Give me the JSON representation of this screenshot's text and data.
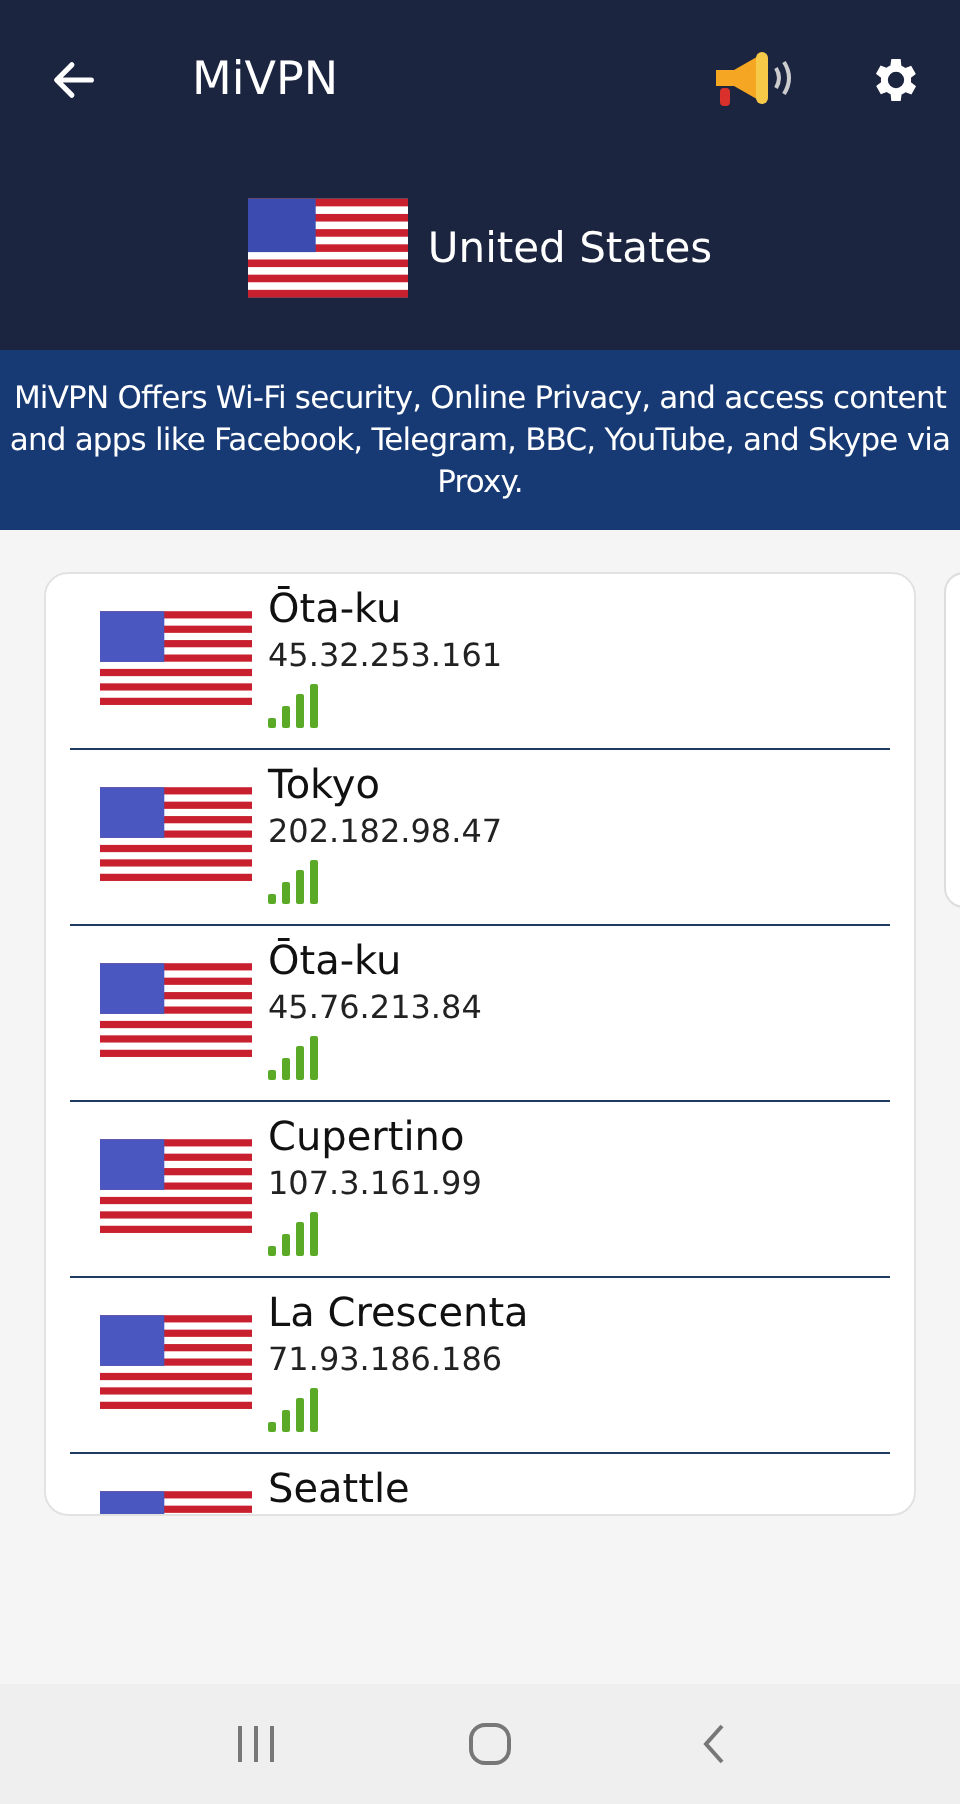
{
  "app_bar": {
    "title": "MiVPN"
  },
  "country": {
    "name": "United States"
  },
  "banner": {
    "text": "MiVPN Offers Wi-Fi security, Online Privacy, and access content and apps like Facebook, Telegram, BBC, YouTube, and Skype via Proxy."
  },
  "servers": [
    {
      "city": "Ōta-ku",
      "ip": "45.32.253.161"
    },
    {
      "city": "Tokyo",
      "ip": "202.182.98.47"
    },
    {
      "city": "Ōta-ku",
      "ip": "45.76.213.84"
    },
    {
      "city": "Cupertino",
      "ip": "107.3.161.99"
    },
    {
      "city": "La Crescenta",
      "ip": "71.93.186.186"
    },
    {
      "city": "Seattle"
    }
  ]
}
